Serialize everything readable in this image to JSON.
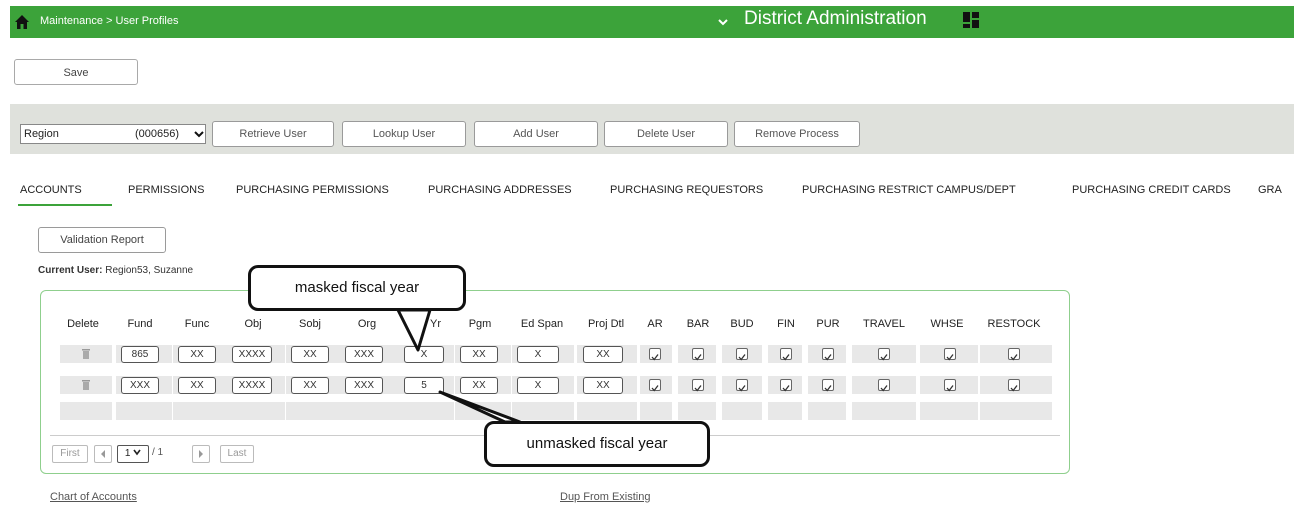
{
  "header": {
    "breadcrumb": "Maintenance > User Profiles",
    "district": "District Administration",
    "bg_color": "#3ca33a"
  },
  "toolbar": {
    "save_label": "Save"
  },
  "user_select": {
    "name": "Region",
    "code": "(000656)"
  },
  "actions": {
    "retrieve": "Retrieve User",
    "lookup": "Lookup User",
    "add": "Add User",
    "delete": "Delete User",
    "remove": "Remove Process"
  },
  "tabs": [
    "ACCOUNTS",
    "PERMISSIONS",
    "PURCHASING PERMISSIONS",
    "PURCHASING ADDRESSES",
    "PURCHASING REQUESTORS",
    "PURCHASING RESTRICT CAMPUS/DEPT",
    "PURCHASING CREDIT CARDS",
    "GRA"
  ],
  "active_tab": "ACCOUNTS",
  "validation_label": "Validation Report",
  "current_user": {
    "label": "Current User:",
    "value": "Region53, Suzanne"
  },
  "grid": {
    "columns": [
      "Delete",
      "Fund",
      "Func",
      "Obj",
      "Sobj",
      "Org",
      "Fscl Yr",
      "Pgm",
      "Ed Span",
      "Proj Dtl",
      "AR",
      "BAR",
      "BUD",
      "FIN",
      "PUR",
      "TRAVEL",
      "WHSE",
      "RESTOCK"
    ],
    "rows": [
      {
        "fund": "865",
        "func": "XX",
        "obj": "XXXX",
        "sobj": "XX",
        "org": "XXX",
        "fscl_yr": "X",
        "pgm": "XX",
        "ed_span": "X",
        "proj_dtl": "XX",
        "AR": true,
        "BAR": true,
        "BUD": true,
        "FIN": true,
        "PUR": true,
        "TRAVEL": true,
        "WHSE": true,
        "RESTOCK": true
      },
      {
        "fund": "XXX",
        "func": "XX",
        "obj": "XXXX",
        "sobj": "XX",
        "org": "XXX",
        "fscl_yr": "5",
        "pgm": "XX",
        "ed_span": "X",
        "proj_dtl": "XX",
        "AR": true,
        "BAR": true,
        "BUD": true,
        "FIN": true,
        "PUR": true,
        "TRAVEL": true,
        "WHSE": true,
        "RESTOCK": true
      }
    ]
  },
  "pagination": {
    "first": "First",
    "page": "1",
    "of": "/ 1",
    "last": "Last"
  },
  "links": {
    "chart": "Chart of Accounts",
    "dup": "Dup From Existing"
  },
  "callouts": {
    "masked": "masked fiscal year",
    "unmasked": "unmasked fiscal year"
  }
}
